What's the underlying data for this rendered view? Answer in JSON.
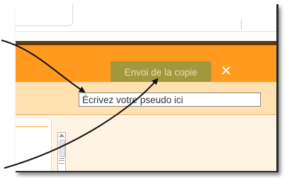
{
  "toolbar": {
    "send_copy_label": "Envoi de la copie",
    "close_glyph": "✕",
    "close_icon": "close-icon"
  },
  "pseudo": {
    "placeholder": "Écrivez votre pseudo ici"
  },
  "colors": {
    "orange_bar": "#ff9a1e",
    "sub_bar": "#ffe0b0",
    "send_button": "#a3973e",
    "content_bg": "#fff3e3",
    "annotation_arrows": "#111111"
  },
  "annotations": {
    "arrow_count": 2,
    "arrow_icon": "annotation-arrow"
  }
}
